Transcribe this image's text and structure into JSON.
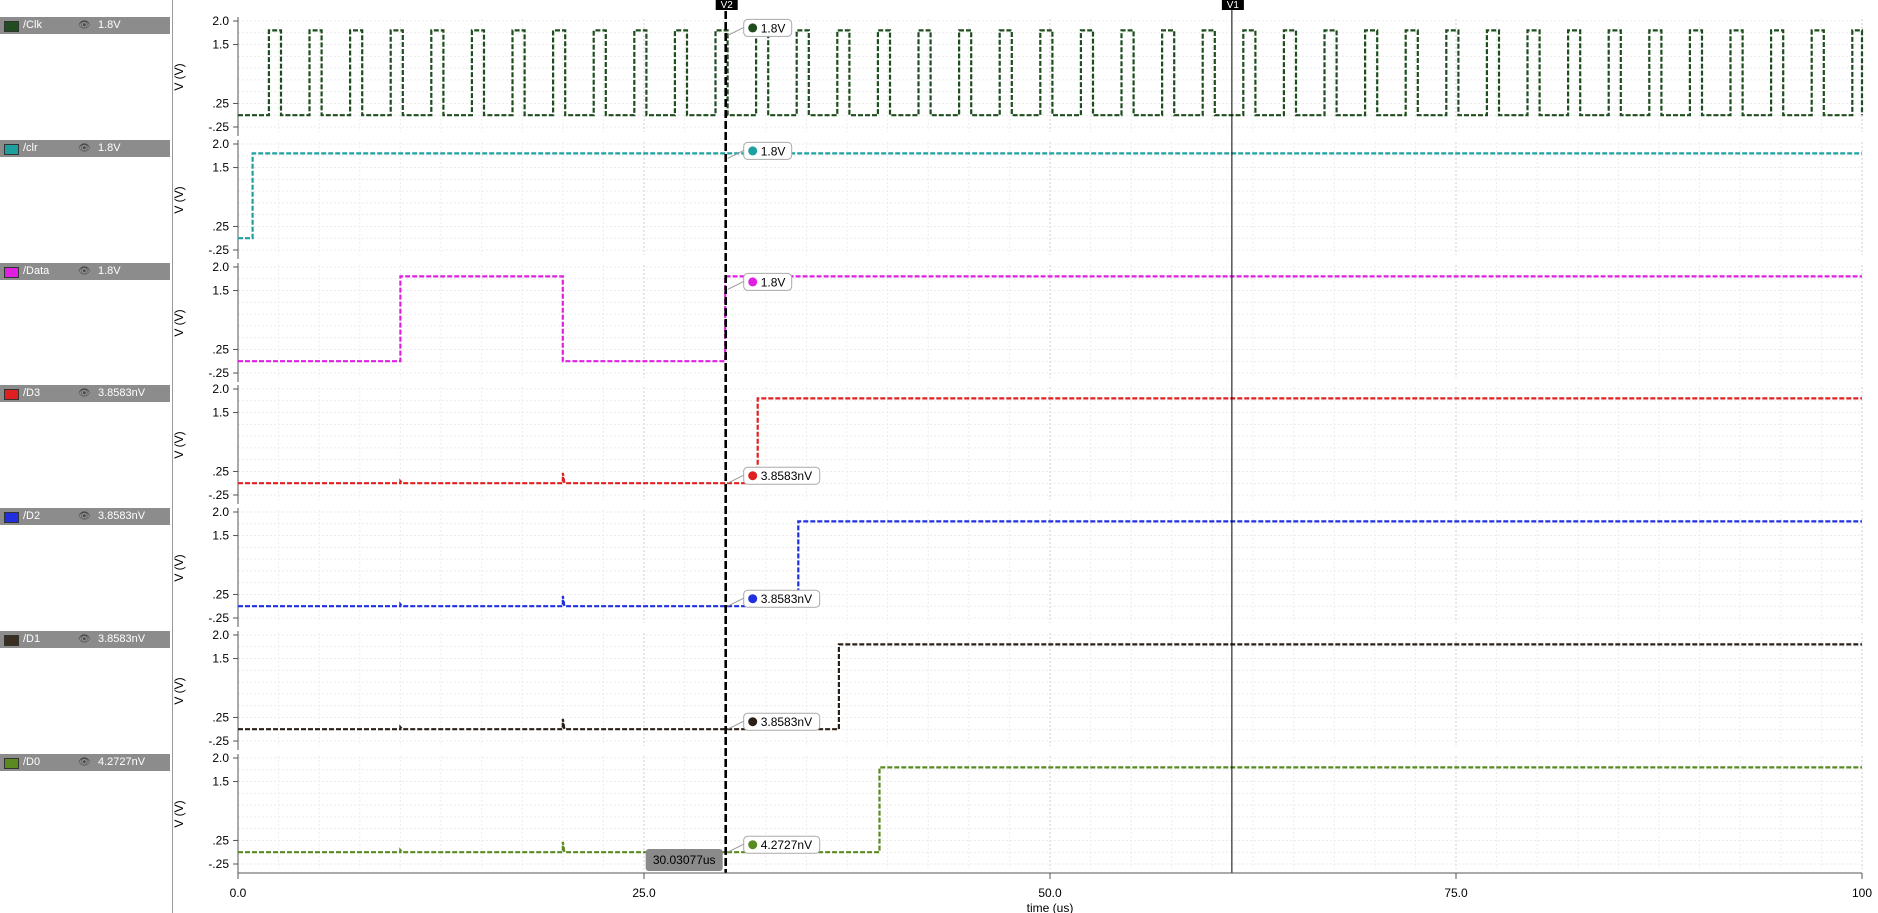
{
  "legend": [
    {
      "name": "/Clk",
      "value": "1.8V",
      "color": "#1f4d1f"
    },
    {
      "name": "/clr",
      "value": "1.8V",
      "color": "#1fa0a0"
    },
    {
      "name": "/Data",
      "value": "1.8V",
      "color": "#e020e0"
    },
    {
      "name": "/D3",
      "value": "3.8583nV",
      "color": "#e02020"
    },
    {
      "name": "/D2",
      "value": "3.8583nV",
      "color": "#2030e0"
    },
    {
      "name": "/D1",
      "value": "3.8583nV",
      "color": "#3a2e20"
    },
    {
      "name": "/D0",
      "value": "4.2727nV",
      "color": "#5a8a20"
    }
  ],
  "legend_eye_glyph": "👁",
  "chart_data": {
    "type": "line",
    "xlabel": "time (us)",
    "ylabel": "V (V)",
    "xlim": [
      0,
      100
    ],
    "ylim": [
      -0.25,
      2.0
    ],
    "x_ticks": [
      0,
      25,
      50,
      75,
      100
    ],
    "x_tick_labels": [
      "0.0",
      "25.0",
      "50.0",
      "75.0",
      "100"
    ],
    "y_ticks": [
      2.0,
      1.5,
      0.25,
      -0.25
    ],
    "y_tick_labels": [
      "2.0",
      "1.5",
      ".25",
      "-.25"
    ],
    "grid": true,
    "series": [
      {
        "name": "/Clk",
        "color": "#1f4d1f",
        "type": "clock",
        "low": 0.0,
        "high": 1.8,
        "period": 2.5,
        "high_start": 1.9,
        "high_width": 0.75,
        "marker_value": "1.8V"
      },
      {
        "name": "/clr",
        "color": "#1fa0a0",
        "points": [
          [
            0,
            0
          ],
          [
            0.9,
            0
          ],
          [
            0.9,
            1.8
          ],
          [
            100,
            1.8
          ]
        ],
        "marker_value": "1.8V"
      },
      {
        "name": "/Data",
        "color": "#e020e0",
        "points": [
          [
            0,
            0
          ],
          [
            10,
            0
          ],
          [
            10,
            1.8
          ],
          [
            20,
            1.8
          ],
          [
            20,
            0
          ],
          [
            30,
            0
          ],
          [
            30,
            1.8
          ],
          [
            100,
            1.8
          ]
        ],
        "marker_value": "1.8V"
      },
      {
        "name": "/D3",
        "color": "#e02020",
        "points": [
          [
            0,
            0
          ],
          [
            10,
            0
          ],
          [
            10,
            0.04
          ],
          [
            10.1,
            0
          ],
          [
            20,
            0
          ],
          [
            20,
            0.22
          ],
          [
            20.1,
            0
          ],
          [
            32,
            0
          ],
          [
            32,
            1.8
          ],
          [
            100,
            1.8
          ]
        ],
        "marker_value": "3.8583nV"
      },
      {
        "name": "/D2",
        "color": "#2030e0",
        "points": [
          [
            0,
            0
          ],
          [
            10,
            0
          ],
          [
            10,
            0.04
          ],
          [
            10.1,
            0
          ],
          [
            20,
            0
          ],
          [
            20,
            0.22
          ],
          [
            20.1,
            0
          ],
          [
            34.5,
            0
          ],
          [
            34.5,
            1.8
          ],
          [
            100,
            1.8
          ]
        ],
        "marker_value": "3.8583nV"
      },
      {
        "name": "/D1",
        "color": "#2a2018",
        "points": [
          [
            0,
            0
          ],
          [
            10,
            0
          ],
          [
            10,
            0.04
          ],
          [
            10.1,
            0
          ],
          [
            20,
            0
          ],
          [
            20,
            0.22
          ],
          [
            20.1,
            0
          ],
          [
            37,
            0
          ],
          [
            37,
            1.8
          ],
          [
            100,
            1.8
          ]
        ],
        "marker_value": "3.8583nV"
      },
      {
        "name": "/D0",
        "color": "#5a8a20",
        "points": [
          [
            0,
            0
          ],
          [
            10,
            0
          ],
          [
            10,
            0.04
          ],
          [
            10.1,
            0
          ],
          [
            20,
            0
          ],
          [
            20,
            0.22
          ],
          [
            20.1,
            0
          ],
          [
            39.5,
            0
          ],
          [
            39.5,
            1.8
          ],
          [
            100,
            1.8
          ]
        ],
        "marker_value": "4.2727nV"
      }
    ],
    "cursors": [
      {
        "label": "V2",
        "x": 30.03077,
        "style": "bold-dashed",
        "readout": "30.03077us"
      },
      {
        "label": "V1",
        "x": 61.2,
        "style": "thin"
      }
    ],
    "marker_y_values": [
      1.8,
      1.8,
      1.8,
      0,
      0,
      0,
      0
    ]
  }
}
